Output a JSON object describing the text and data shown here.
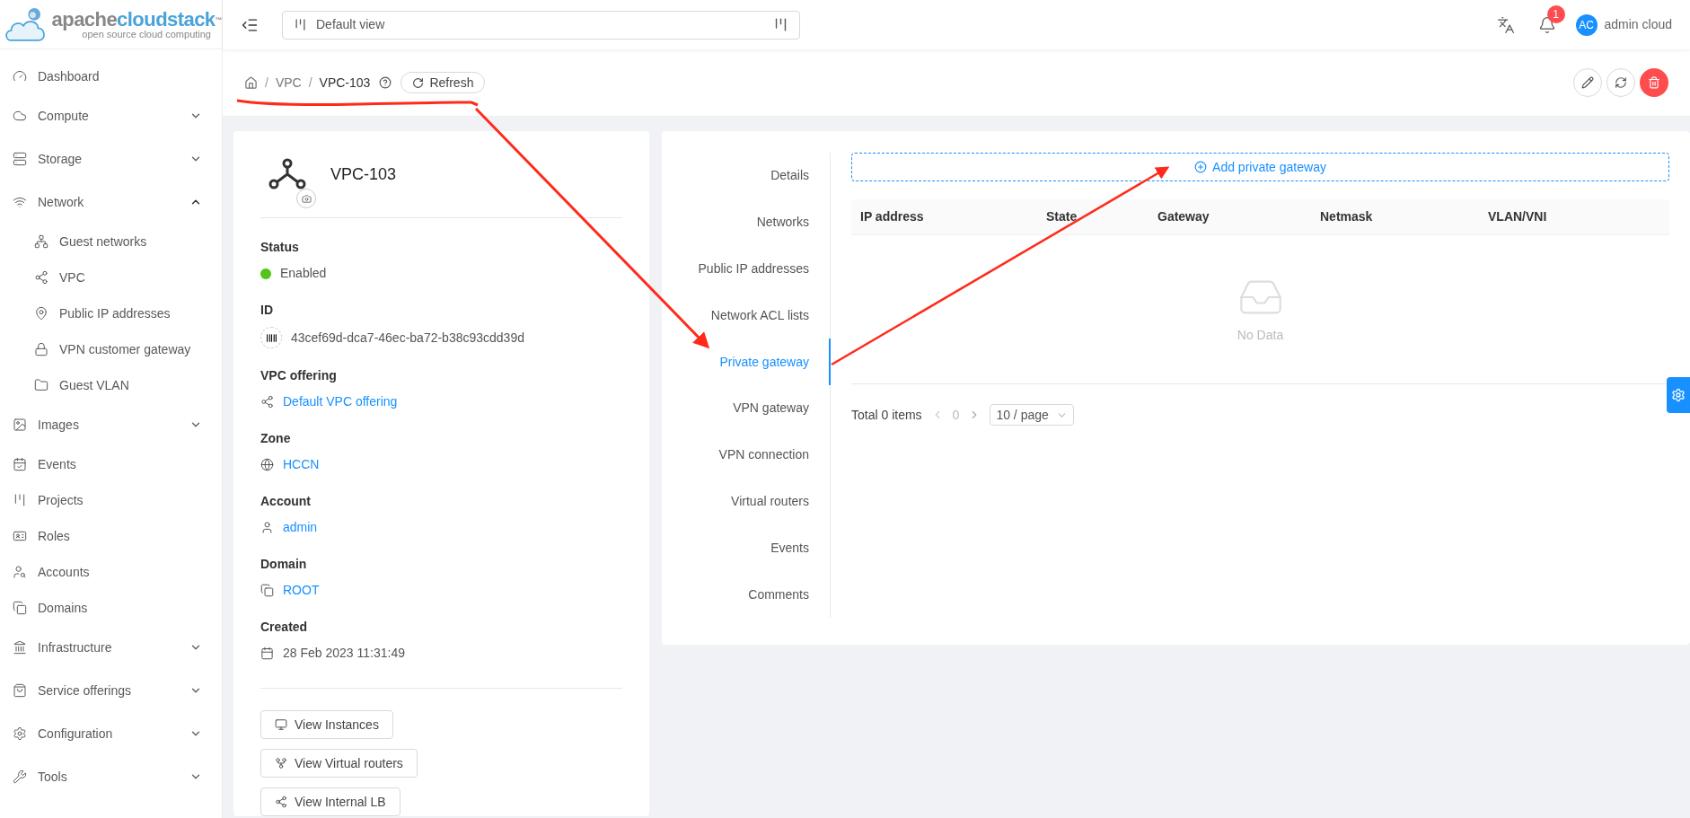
{
  "logo": {
    "primary": "apache",
    "secondary": "cloudstack",
    "trademark": "™",
    "tagline": "open source cloud computing"
  },
  "header": {
    "view_selector": {
      "value": "Default view"
    },
    "notification_count": "1",
    "user": {
      "initials": "AC",
      "name": "admin cloud"
    }
  },
  "sidebar": {
    "items": [
      {
        "label": "Dashboard",
        "kind": "link"
      },
      {
        "label": "Compute",
        "kind": "group",
        "expanded": false
      },
      {
        "label": "Storage",
        "kind": "group",
        "expanded": false
      },
      {
        "label": "Network",
        "kind": "group",
        "expanded": true,
        "children": [
          {
            "label": "Guest networks"
          },
          {
            "label": "VPC"
          },
          {
            "label": "Public IP addresses"
          },
          {
            "label": "VPN customer gateway"
          },
          {
            "label": "Guest VLAN"
          }
        ]
      },
      {
        "label": "Images",
        "kind": "group",
        "expanded": false
      },
      {
        "label": "Events",
        "kind": "link"
      },
      {
        "label": "Projects",
        "kind": "link"
      },
      {
        "label": "Roles",
        "kind": "link"
      },
      {
        "label": "Accounts",
        "kind": "link"
      },
      {
        "label": "Domains",
        "kind": "link"
      },
      {
        "label": "Infrastructure",
        "kind": "group",
        "expanded": false
      },
      {
        "label": "Service offerings",
        "kind": "group",
        "expanded": false
      },
      {
        "label": "Configuration",
        "kind": "group",
        "expanded": false
      },
      {
        "label": "Tools",
        "kind": "group",
        "expanded": false
      }
    ]
  },
  "breadcrumb": {
    "separator": "/",
    "items": [
      "VPC",
      "VPC-103"
    ],
    "refresh_button": "Refresh"
  },
  "resource": {
    "title": "VPC-103",
    "fields": [
      {
        "kind": "status",
        "label": "Status",
        "value": "Enabled",
        "color": "#52c41a"
      },
      {
        "kind": "id",
        "label": "ID",
        "value": "43cef69d-dca7-46ec-ba72-b38c93cdd39d"
      },
      {
        "kind": "offering",
        "label": "VPC offering",
        "value": "Default VPC offering"
      },
      {
        "kind": "zone",
        "label": "Zone",
        "value": "HCCN"
      },
      {
        "kind": "account",
        "label": "Account",
        "value": "admin"
      },
      {
        "kind": "domain",
        "label": "Domain",
        "value": "ROOT"
      },
      {
        "kind": "date",
        "label": "Created",
        "value": "28 Feb 2023 11:31:49"
      }
    ],
    "buttons": [
      "View Instances",
      "View Virtual routers",
      "View Internal LB"
    ]
  },
  "tabs": [
    {
      "label": "Details",
      "selected": false
    },
    {
      "label": "Networks",
      "selected": false
    },
    {
      "label": "Public IP addresses",
      "selected": false
    },
    {
      "label": "Network ACL lists",
      "selected": false
    },
    {
      "label": "Private gateway",
      "selected": true
    },
    {
      "label": "VPN gateway",
      "selected": false
    },
    {
      "label": "VPN connection",
      "selected": false
    },
    {
      "label": "Virtual routers",
      "selected": false
    },
    {
      "label": "Events",
      "selected": false
    },
    {
      "label": "Comments",
      "selected": false
    }
  ],
  "add_button": "Add private gateway",
  "table": {
    "columns": [
      "IP address",
      "State",
      "Gateway",
      "Netmask",
      "VLAN/VNI"
    ],
    "empty_text": "No Data"
  },
  "pagination": {
    "total": "Total 0 items",
    "page": "0",
    "page_size": "10 / page"
  }
}
